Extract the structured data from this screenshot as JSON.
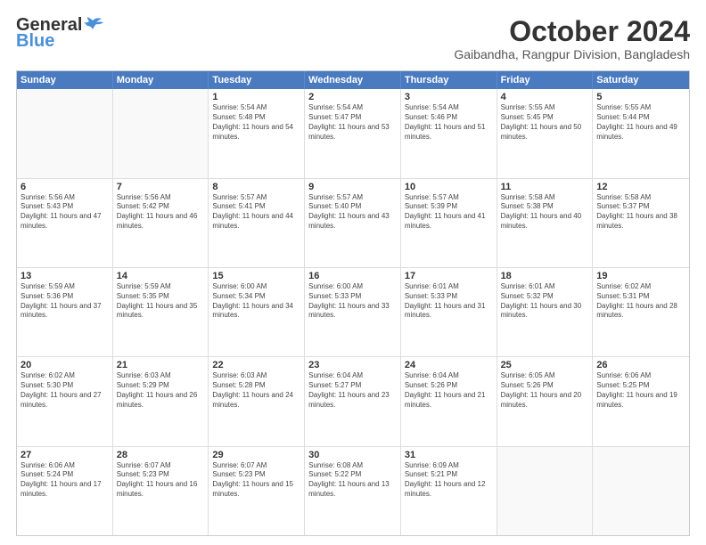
{
  "header": {
    "logo_line1": "General",
    "logo_line2": "Blue",
    "month": "October 2024",
    "location": "Gaibandha, Rangpur Division, Bangladesh"
  },
  "weekdays": [
    "Sunday",
    "Monday",
    "Tuesday",
    "Wednesday",
    "Thursday",
    "Friday",
    "Saturday"
  ],
  "rows": [
    [
      {
        "day": "",
        "sunrise": "",
        "sunset": "",
        "daylight": ""
      },
      {
        "day": "",
        "sunrise": "",
        "sunset": "",
        "daylight": ""
      },
      {
        "day": "1",
        "sunrise": "Sunrise: 5:54 AM",
        "sunset": "Sunset: 5:48 PM",
        "daylight": "Daylight: 11 hours and 54 minutes."
      },
      {
        "day": "2",
        "sunrise": "Sunrise: 5:54 AM",
        "sunset": "Sunset: 5:47 PM",
        "daylight": "Daylight: 11 hours and 53 minutes."
      },
      {
        "day": "3",
        "sunrise": "Sunrise: 5:54 AM",
        "sunset": "Sunset: 5:46 PM",
        "daylight": "Daylight: 11 hours and 51 minutes."
      },
      {
        "day": "4",
        "sunrise": "Sunrise: 5:55 AM",
        "sunset": "Sunset: 5:45 PM",
        "daylight": "Daylight: 11 hours and 50 minutes."
      },
      {
        "day": "5",
        "sunrise": "Sunrise: 5:55 AM",
        "sunset": "Sunset: 5:44 PM",
        "daylight": "Daylight: 11 hours and 49 minutes."
      }
    ],
    [
      {
        "day": "6",
        "sunrise": "Sunrise: 5:56 AM",
        "sunset": "Sunset: 5:43 PM",
        "daylight": "Daylight: 11 hours and 47 minutes."
      },
      {
        "day": "7",
        "sunrise": "Sunrise: 5:56 AM",
        "sunset": "Sunset: 5:42 PM",
        "daylight": "Daylight: 11 hours and 46 minutes."
      },
      {
        "day": "8",
        "sunrise": "Sunrise: 5:57 AM",
        "sunset": "Sunset: 5:41 PM",
        "daylight": "Daylight: 11 hours and 44 minutes."
      },
      {
        "day": "9",
        "sunrise": "Sunrise: 5:57 AM",
        "sunset": "Sunset: 5:40 PM",
        "daylight": "Daylight: 11 hours and 43 minutes."
      },
      {
        "day": "10",
        "sunrise": "Sunrise: 5:57 AM",
        "sunset": "Sunset: 5:39 PM",
        "daylight": "Daylight: 11 hours and 41 minutes."
      },
      {
        "day": "11",
        "sunrise": "Sunrise: 5:58 AM",
        "sunset": "Sunset: 5:38 PM",
        "daylight": "Daylight: 11 hours and 40 minutes."
      },
      {
        "day": "12",
        "sunrise": "Sunrise: 5:58 AM",
        "sunset": "Sunset: 5:37 PM",
        "daylight": "Daylight: 11 hours and 38 minutes."
      }
    ],
    [
      {
        "day": "13",
        "sunrise": "Sunrise: 5:59 AM",
        "sunset": "Sunset: 5:36 PM",
        "daylight": "Daylight: 11 hours and 37 minutes."
      },
      {
        "day": "14",
        "sunrise": "Sunrise: 5:59 AM",
        "sunset": "Sunset: 5:35 PM",
        "daylight": "Daylight: 11 hours and 35 minutes."
      },
      {
        "day": "15",
        "sunrise": "Sunrise: 6:00 AM",
        "sunset": "Sunset: 5:34 PM",
        "daylight": "Daylight: 11 hours and 34 minutes."
      },
      {
        "day": "16",
        "sunrise": "Sunrise: 6:00 AM",
        "sunset": "Sunset: 5:33 PM",
        "daylight": "Daylight: 11 hours and 33 minutes."
      },
      {
        "day": "17",
        "sunrise": "Sunrise: 6:01 AM",
        "sunset": "Sunset: 5:33 PM",
        "daylight": "Daylight: 11 hours and 31 minutes."
      },
      {
        "day": "18",
        "sunrise": "Sunrise: 6:01 AM",
        "sunset": "Sunset: 5:32 PM",
        "daylight": "Daylight: 11 hours and 30 minutes."
      },
      {
        "day": "19",
        "sunrise": "Sunrise: 6:02 AM",
        "sunset": "Sunset: 5:31 PM",
        "daylight": "Daylight: 11 hours and 28 minutes."
      }
    ],
    [
      {
        "day": "20",
        "sunrise": "Sunrise: 6:02 AM",
        "sunset": "Sunset: 5:30 PM",
        "daylight": "Daylight: 11 hours and 27 minutes."
      },
      {
        "day": "21",
        "sunrise": "Sunrise: 6:03 AM",
        "sunset": "Sunset: 5:29 PM",
        "daylight": "Daylight: 11 hours and 26 minutes."
      },
      {
        "day": "22",
        "sunrise": "Sunrise: 6:03 AM",
        "sunset": "Sunset: 5:28 PM",
        "daylight": "Daylight: 11 hours and 24 minutes."
      },
      {
        "day": "23",
        "sunrise": "Sunrise: 6:04 AM",
        "sunset": "Sunset: 5:27 PM",
        "daylight": "Daylight: 11 hours and 23 minutes."
      },
      {
        "day": "24",
        "sunrise": "Sunrise: 6:04 AM",
        "sunset": "Sunset: 5:26 PM",
        "daylight": "Daylight: 11 hours and 21 minutes."
      },
      {
        "day": "25",
        "sunrise": "Sunrise: 6:05 AM",
        "sunset": "Sunset: 5:26 PM",
        "daylight": "Daylight: 11 hours and 20 minutes."
      },
      {
        "day": "26",
        "sunrise": "Sunrise: 6:06 AM",
        "sunset": "Sunset: 5:25 PM",
        "daylight": "Daylight: 11 hours and 19 minutes."
      }
    ],
    [
      {
        "day": "27",
        "sunrise": "Sunrise: 6:06 AM",
        "sunset": "Sunset: 5:24 PM",
        "daylight": "Daylight: 11 hours and 17 minutes."
      },
      {
        "day": "28",
        "sunrise": "Sunrise: 6:07 AM",
        "sunset": "Sunset: 5:23 PM",
        "daylight": "Daylight: 11 hours and 16 minutes."
      },
      {
        "day": "29",
        "sunrise": "Sunrise: 6:07 AM",
        "sunset": "Sunset: 5:23 PM",
        "daylight": "Daylight: 11 hours and 15 minutes."
      },
      {
        "day": "30",
        "sunrise": "Sunrise: 6:08 AM",
        "sunset": "Sunset: 5:22 PM",
        "daylight": "Daylight: 11 hours and 13 minutes."
      },
      {
        "day": "31",
        "sunrise": "Sunrise: 6:09 AM",
        "sunset": "Sunset: 5:21 PM",
        "daylight": "Daylight: 11 hours and 12 minutes."
      },
      {
        "day": "",
        "sunrise": "",
        "sunset": "",
        "daylight": ""
      },
      {
        "day": "",
        "sunrise": "",
        "sunset": "",
        "daylight": ""
      }
    ]
  ]
}
